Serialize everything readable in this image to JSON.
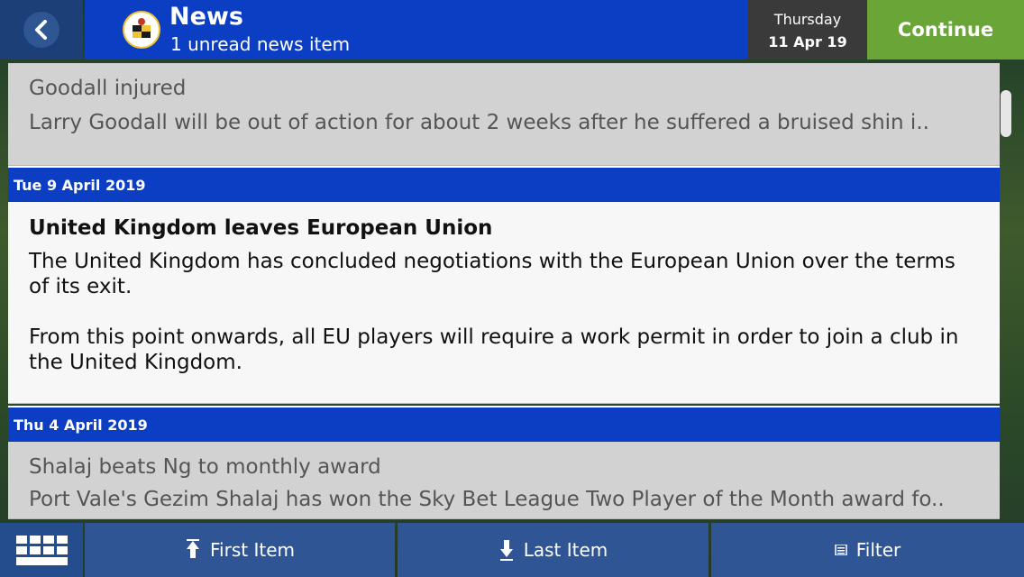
{
  "header": {
    "title": "News",
    "subtitle": "1 unread news item",
    "date_day": "Thursday",
    "date_short": "11 Apr 19",
    "continue_label": "Continue"
  },
  "news": [
    {
      "title": "Goodall injured",
      "snippet": "Larry Goodall will be out of action for about 2 weeks after he suffered a bruised shin i.."
    },
    {
      "date_header": "Tue 9 April 2019",
      "title": "United Kingdom leaves European Union",
      "paragraph1": "The United Kingdom has concluded negotiations with the European Union over the terms of its exit.",
      "paragraph2": "From this point onwards, all EU players will require a work permit in order to join a club in the United Kingdom."
    },
    {
      "date_header": "Thu 4 April 2019",
      "title": "Shalaj beats Ng to monthly award",
      "snippet": "Port Vale's Gezim Shalaj has won the Sky Bet League Two Player of the Month award fo.."
    }
  ],
  "bottom_bar": {
    "first_item_label": "First Item",
    "last_item_label": "Last Item",
    "filter_label": "Filter"
  },
  "colors": {
    "header_blue": "#0b3ec2",
    "continue_green": "#6aa538",
    "date_box": "#3a3a3a",
    "bottom_blue": "#2f5594"
  },
  "icons": [
    "back-arrow-icon",
    "club-crest-icon",
    "arrow-up-icon",
    "arrow-down-icon",
    "filter-list-icon",
    "grid-menu-icon"
  ]
}
